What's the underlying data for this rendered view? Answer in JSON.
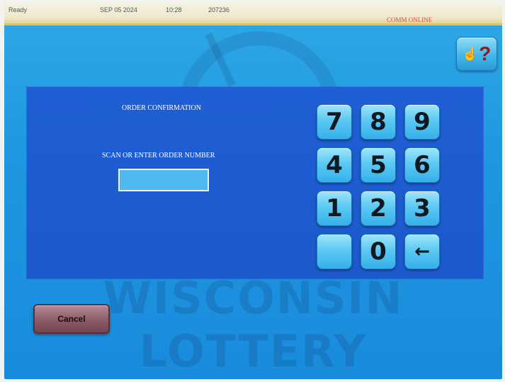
{
  "status_bar": {
    "state": "Ready",
    "date": "SEP 05 2024",
    "time": "10:28",
    "id": "207236",
    "connection": "COMM ONLINE"
  },
  "background": {
    "watermark_line1": "WISCONSIN",
    "watermark_line2": "LOTTERY"
  },
  "help": {
    "icon": "hand-question-icon",
    "label": "?"
  },
  "dialog": {
    "title": "ORDER CONFIRMATION",
    "prompt": "SCAN OR ENTER ORDER NUMBER",
    "order_value": ""
  },
  "keypad": {
    "keys": [
      {
        "label": "7"
      },
      {
        "label": "8"
      },
      {
        "label": "9"
      },
      {
        "label": "4"
      },
      {
        "label": "5"
      },
      {
        "label": "6"
      },
      {
        "label": "1"
      },
      {
        "label": "2"
      },
      {
        "label": "3"
      },
      {
        "label": ""
      },
      {
        "label": "0"
      },
      {
        "label": "←"
      }
    ]
  },
  "actions": {
    "cancel_label": "Cancel"
  },
  "colors": {
    "screen": "#1f97e2",
    "panel": "#1f5fd4",
    "status_accent": "#e2c24a",
    "comm_online": "#e24a3a",
    "cancel": "#8c5b68"
  }
}
